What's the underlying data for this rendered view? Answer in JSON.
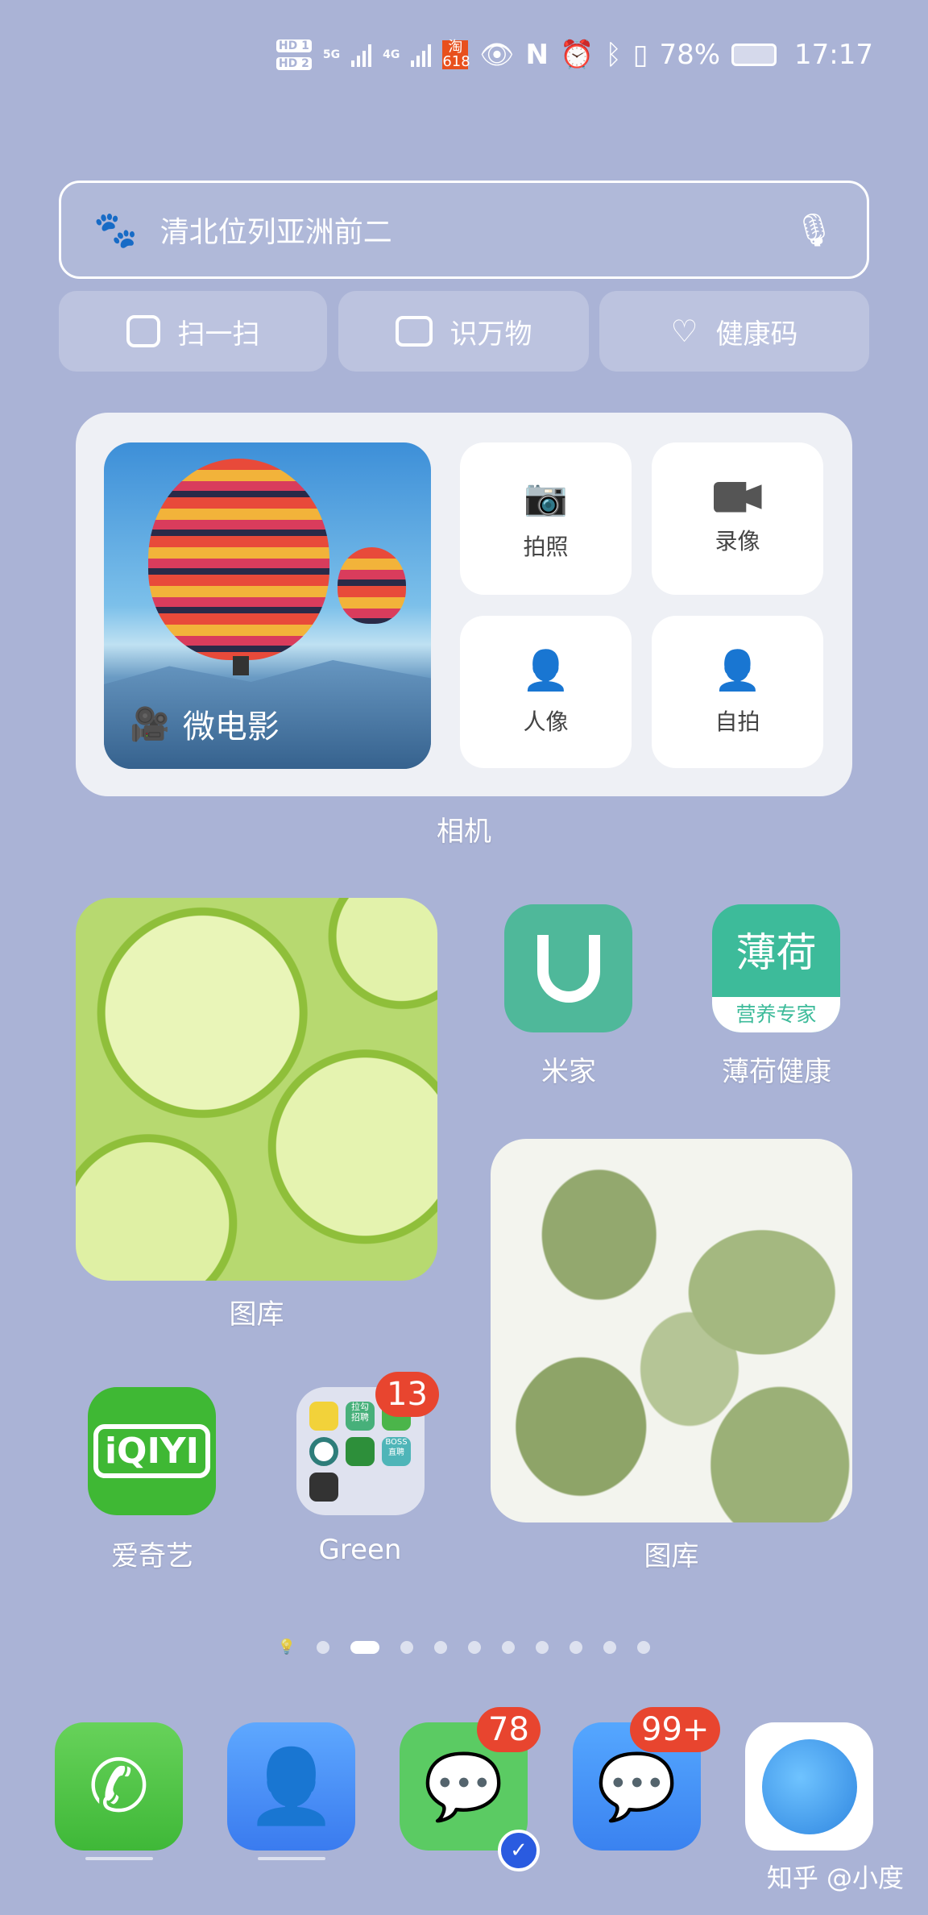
{
  "status_bar": {
    "sim1": "HD 1",
    "sim2": "HD 2",
    "net1": "5G",
    "net2": "4G",
    "taobao_badge": "淘 618",
    "battery": "78%",
    "time": "17:17",
    "icons": [
      "eye-icon",
      "nfc-icon",
      "alarm-icon",
      "bluetooth-icon",
      "vibrate-icon",
      "battery-charging-icon"
    ]
  },
  "search": {
    "placeholder": "清北位列亚洲前二",
    "left_icon": "baidu-paw-icon",
    "right_icon": "microphone-icon"
  },
  "quick_actions": [
    {
      "label": "扫一扫",
      "icon": "scan-icon"
    },
    {
      "label": "识万物",
      "icon": "camera-icon"
    },
    {
      "label": "健康码",
      "icon": "health-code-icon"
    }
  ],
  "camera_widget": {
    "video_label": "微电影",
    "tiles": [
      {
        "label": "拍照",
        "icon": "camera-icon"
      },
      {
        "label": "录像",
        "icon": "video-icon"
      },
      {
        "label": "人像",
        "icon": "portrait-icon"
      },
      {
        "label": "自拍",
        "icon": "selfie-icon"
      }
    ],
    "name": "相机"
  },
  "apps": {
    "gallery1": "图库",
    "gallery2": "图库",
    "mijia": "米家",
    "bohe": {
      "label": "薄荷健康",
      "icon_top": "薄荷",
      "icon_bottom": "营养专家"
    },
    "iqiyi": {
      "label": "爱奇艺",
      "icon_text": "iQIYI"
    },
    "folder": {
      "label": "Green",
      "badge": "13",
      "minis": [
        "QQ音乐",
        "拉勾 招聘",
        "微信",
        "国家电网",
        "叮咚",
        "BOSS 直聘",
        "森林"
      ]
    }
  },
  "page_dots": {
    "count": 10,
    "active": 2
  },
  "dock": [
    {
      "name": "phone",
      "badge": ""
    },
    {
      "name": "contacts",
      "badge": ""
    },
    {
      "name": "wechat",
      "badge": "78"
    },
    {
      "name": "messages",
      "badge": "99+"
    },
    {
      "name": "browser",
      "badge": ""
    }
  ],
  "watermark": "知乎 @小度"
}
